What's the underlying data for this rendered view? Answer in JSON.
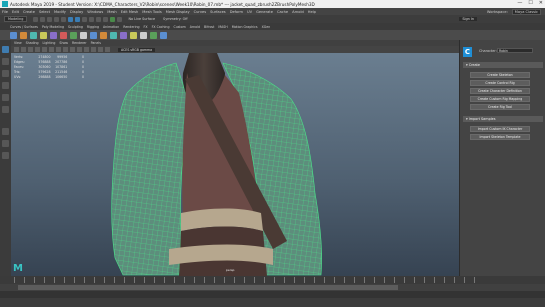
{
  "window": {
    "title": "Autodesk Maya 2019 - Student Version: X:\\CDMA_Characters_V2\\Robin\\scenes\\Week10\\Robin_07.mb* --- jacket_quad_zbrush2ZBrushPolyMesh3D",
    "controls": [
      "—",
      "☐",
      "✕"
    ]
  },
  "menubar": {
    "items": [
      "File",
      "Edit",
      "Create",
      "Select",
      "Modify",
      "Display",
      "Windows",
      "Mesh",
      "Edit Mesh",
      "Mesh Tools",
      "Mesh Display",
      "Curves",
      "Surfaces",
      "Deform",
      "UV",
      "Generate",
      "Cache",
      "Arnold",
      "Help"
    ],
    "workspace_label": "Workspace:",
    "workspace_value": "Maya Classic"
  },
  "statusline": {
    "menuset": "Modeling",
    "live_surface": "No Live Surface",
    "symmetry": "Symmetry: Off",
    "signin": "Sign In"
  },
  "shelf": {
    "tabs": [
      "Curves / Surfaces",
      "Poly Modeling",
      "Sculpting",
      "Rigging",
      "Animation",
      "Rendering",
      "FX",
      "FX Caching",
      "Custom",
      "Arnold",
      "Bifrost",
      "MASH",
      "Motion Graphics",
      "XGen"
    ],
    "icon_colors": [
      "#5b8fd1",
      "#d28a3a",
      "#4fb8b0",
      "#c9c95a",
      "#8a6fc9",
      "#d25a5a",
      "#5aa05a",
      "#cfcfcf",
      "#5b8fd1",
      "#d28a3a",
      "#4fb8b0",
      "#8a6fc9",
      "#c9c95a",
      "#cfcfcf",
      "#5aa05a",
      "#5b8fd1"
    ]
  },
  "viewport": {
    "menu": [
      "View",
      "Shading",
      "Lighting",
      "Show",
      "Renderer",
      "Panels"
    ],
    "camera_selector": "ACES sRGB gamma",
    "hud": {
      "columns": [
        "",
        "",
        "",
        ""
      ],
      "rows": [
        {
          "label": "Verts:",
          "vals": [
            "274800",
            "99956",
            "0"
          ]
        },
        {
          "label": "Edges:",
          "vals": [
            "576888",
            "207786",
            "0"
          ]
        },
        {
          "label": "Faces:",
          "vals": [
            "303060",
            "107861",
            "0"
          ]
        },
        {
          "label": "Tris:",
          "vals": [
            "579628",
            "211546",
            "0"
          ]
        },
        {
          "label": "UVs:",
          "vals": [
            "298888",
            "106650",
            "0"
          ]
        }
      ]
    },
    "camera_label": "persp",
    "axis_glyph": "M",
    "colors": {
      "wire": "#4be38a",
      "jacket": "#5d8d7c",
      "skin": "#3f3733",
      "shirt": "#6b4a46",
      "strap": "#4a3a34",
      "belt": "#b6a78e",
      "pants": "#4a3632"
    }
  },
  "right_panel": {
    "logo_letter": "C",
    "character_label": "Character:",
    "character_value": "Robin",
    "sections": [
      {
        "title": "Create",
        "buttons": [
          "Create Skeleton",
          "Create Control Rig",
          "Create Character Definition",
          "Create Custom Rig Mapping",
          "Create Rig Tool"
        ]
      },
      {
        "title": "Import Samples",
        "buttons": [
          "Import Custom IK Character",
          "Import Skeleton Template"
        ]
      }
    ]
  }
}
